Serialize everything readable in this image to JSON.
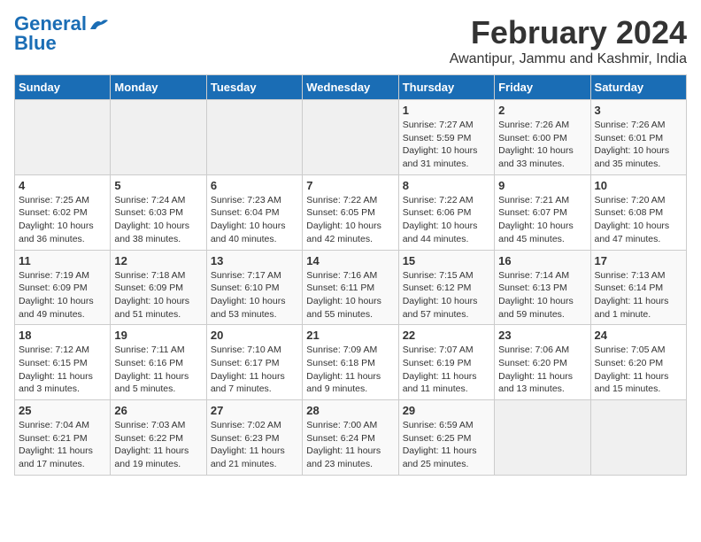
{
  "logo": {
    "line1": "General",
    "line2": "Blue"
  },
  "title": {
    "month_year": "February 2024",
    "location": "Awantipur, Jammu and Kashmir, India"
  },
  "days_of_week": [
    "Sunday",
    "Monday",
    "Tuesday",
    "Wednesday",
    "Thursday",
    "Friday",
    "Saturday"
  ],
  "weeks": [
    [
      {
        "day": "",
        "info": ""
      },
      {
        "day": "",
        "info": ""
      },
      {
        "day": "",
        "info": ""
      },
      {
        "day": "",
        "info": ""
      },
      {
        "day": "1",
        "info": "Sunrise: 7:27 AM\nSunset: 5:59 PM\nDaylight: 10 hours\nand 31 minutes."
      },
      {
        "day": "2",
        "info": "Sunrise: 7:26 AM\nSunset: 6:00 PM\nDaylight: 10 hours\nand 33 minutes."
      },
      {
        "day": "3",
        "info": "Sunrise: 7:26 AM\nSunset: 6:01 PM\nDaylight: 10 hours\nand 35 minutes."
      }
    ],
    [
      {
        "day": "4",
        "info": "Sunrise: 7:25 AM\nSunset: 6:02 PM\nDaylight: 10 hours\nand 36 minutes."
      },
      {
        "day": "5",
        "info": "Sunrise: 7:24 AM\nSunset: 6:03 PM\nDaylight: 10 hours\nand 38 minutes."
      },
      {
        "day": "6",
        "info": "Sunrise: 7:23 AM\nSunset: 6:04 PM\nDaylight: 10 hours\nand 40 minutes."
      },
      {
        "day": "7",
        "info": "Sunrise: 7:22 AM\nSunset: 6:05 PM\nDaylight: 10 hours\nand 42 minutes."
      },
      {
        "day": "8",
        "info": "Sunrise: 7:22 AM\nSunset: 6:06 PM\nDaylight: 10 hours\nand 44 minutes."
      },
      {
        "day": "9",
        "info": "Sunrise: 7:21 AM\nSunset: 6:07 PM\nDaylight: 10 hours\nand 45 minutes."
      },
      {
        "day": "10",
        "info": "Sunrise: 7:20 AM\nSunset: 6:08 PM\nDaylight: 10 hours\nand 47 minutes."
      }
    ],
    [
      {
        "day": "11",
        "info": "Sunrise: 7:19 AM\nSunset: 6:09 PM\nDaylight: 10 hours\nand 49 minutes."
      },
      {
        "day": "12",
        "info": "Sunrise: 7:18 AM\nSunset: 6:09 PM\nDaylight: 10 hours\nand 51 minutes."
      },
      {
        "day": "13",
        "info": "Sunrise: 7:17 AM\nSunset: 6:10 PM\nDaylight: 10 hours\nand 53 minutes."
      },
      {
        "day": "14",
        "info": "Sunrise: 7:16 AM\nSunset: 6:11 PM\nDaylight: 10 hours\nand 55 minutes."
      },
      {
        "day": "15",
        "info": "Sunrise: 7:15 AM\nSunset: 6:12 PM\nDaylight: 10 hours\nand 57 minutes."
      },
      {
        "day": "16",
        "info": "Sunrise: 7:14 AM\nSunset: 6:13 PM\nDaylight: 10 hours\nand 59 minutes."
      },
      {
        "day": "17",
        "info": "Sunrise: 7:13 AM\nSunset: 6:14 PM\nDaylight: 11 hours\nand 1 minute."
      }
    ],
    [
      {
        "day": "18",
        "info": "Sunrise: 7:12 AM\nSunset: 6:15 PM\nDaylight: 11 hours\nand 3 minutes."
      },
      {
        "day": "19",
        "info": "Sunrise: 7:11 AM\nSunset: 6:16 PM\nDaylight: 11 hours\nand 5 minutes."
      },
      {
        "day": "20",
        "info": "Sunrise: 7:10 AM\nSunset: 6:17 PM\nDaylight: 11 hours\nand 7 minutes."
      },
      {
        "day": "21",
        "info": "Sunrise: 7:09 AM\nSunset: 6:18 PM\nDaylight: 11 hours\nand 9 minutes."
      },
      {
        "day": "22",
        "info": "Sunrise: 7:07 AM\nSunset: 6:19 PM\nDaylight: 11 hours\nand 11 minutes."
      },
      {
        "day": "23",
        "info": "Sunrise: 7:06 AM\nSunset: 6:20 PM\nDaylight: 11 hours\nand 13 minutes."
      },
      {
        "day": "24",
        "info": "Sunrise: 7:05 AM\nSunset: 6:20 PM\nDaylight: 11 hours\nand 15 minutes."
      }
    ],
    [
      {
        "day": "25",
        "info": "Sunrise: 7:04 AM\nSunset: 6:21 PM\nDaylight: 11 hours\nand 17 minutes."
      },
      {
        "day": "26",
        "info": "Sunrise: 7:03 AM\nSunset: 6:22 PM\nDaylight: 11 hours\nand 19 minutes."
      },
      {
        "day": "27",
        "info": "Sunrise: 7:02 AM\nSunset: 6:23 PM\nDaylight: 11 hours\nand 21 minutes."
      },
      {
        "day": "28",
        "info": "Sunrise: 7:00 AM\nSunset: 6:24 PM\nDaylight: 11 hours\nand 23 minutes."
      },
      {
        "day": "29",
        "info": "Sunrise: 6:59 AM\nSunset: 6:25 PM\nDaylight: 11 hours\nand 25 minutes."
      },
      {
        "day": "",
        "info": ""
      },
      {
        "day": "",
        "info": ""
      }
    ]
  ]
}
